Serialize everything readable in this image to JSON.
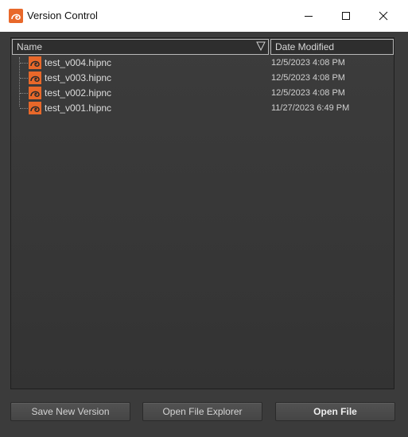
{
  "window": {
    "title": "Version Control",
    "icon": "houdini-app-icon",
    "controls": [
      "minimize-icon",
      "maximize-icon",
      "close-icon"
    ]
  },
  "columns": {
    "name": "Name",
    "date_modified": "Date Modified",
    "sort_indicator": "sort-descending-icon"
  },
  "files": [
    {
      "name": "test_v004.hipnc",
      "date": "12/5/2023 4:08 PM",
      "icon": "houdini-file-icon"
    },
    {
      "name": "test_v003.hipnc",
      "date": "12/5/2023 4:08 PM",
      "icon": "houdini-file-icon"
    },
    {
      "name": "test_v002.hipnc",
      "date": "12/5/2023 4:08 PM",
      "icon": "houdini-file-icon"
    },
    {
      "name": "test_v001.hipnc",
      "date": "11/27/2023 6:49 PM",
      "icon": "houdini-file-icon"
    }
  ],
  "buttons": {
    "save_new_version": "Save New Version",
    "open_file_explorer": "Open File Explorer",
    "open_file": "Open File"
  },
  "colors": {
    "accent": "#e8682a",
    "panel": "#3a3a3a",
    "text": "#dcdcdc"
  }
}
